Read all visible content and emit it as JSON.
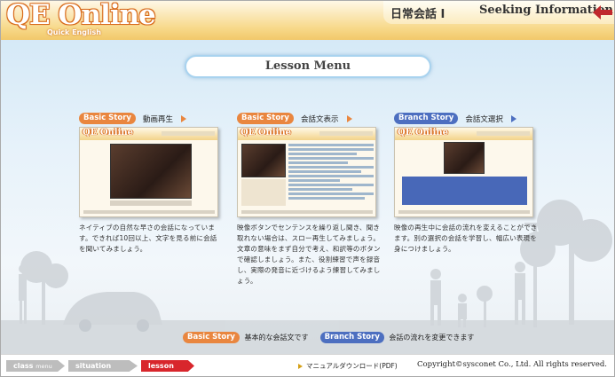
{
  "header": {
    "logo": "QE Online",
    "logo_sub": "Quick English",
    "title_jp": "日常会話 I",
    "title_en": "Seeking Information"
  },
  "lesson_menu": "Lesson Menu",
  "columns": [
    {
      "badge": "Basic Story",
      "label": "動画再生",
      "desc": "ネイティブの自然な早さの会話になっています。できれば10回以上、文字を見る前に会話を聞いてみましょう。"
    },
    {
      "badge": "Basic Story",
      "label": "会話文表示",
      "desc": "映像ボタンでセンテンスを繰り返し聞き、聞き取れない場合は、スロー再生してみましょう。文章の意味をまず自分で考え、和訳等のボタンで確認しましょう。また、役割練習で声を録音し、実際の発音に近づけるよう練習してみましょう。"
    },
    {
      "badge": "Branch Story",
      "label": "会話文選択",
      "desc": "映像の再生中に会話の流れを変えることができます。別の選択の会話を学習し、幅広い表現を身につけましょう。"
    }
  ],
  "legend": {
    "basic_badge": "Basic Story",
    "basic_text": "基本的な会話文です",
    "branch_badge": "Branch Story",
    "branch_text": "会話の流れを変更できます"
  },
  "footer": {
    "nav": [
      {
        "main": "class",
        "sub": "menu"
      },
      {
        "main": "situation",
        "sub": "menu"
      },
      {
        "main": "lesson",
        "sub": "menu"
      }
    ],
    "manual": "マニュアルダウンロード(PDF)",
    "copyright": "Copyright©sysconet Co., Ltd. All rights reserved."
  },
  "colors": {
    "basic": "#e9863f",
    "branch": "#4d6fc0",
    "active_nav": "#d8262c",
    "header": "#f7d98a"
  }
}
